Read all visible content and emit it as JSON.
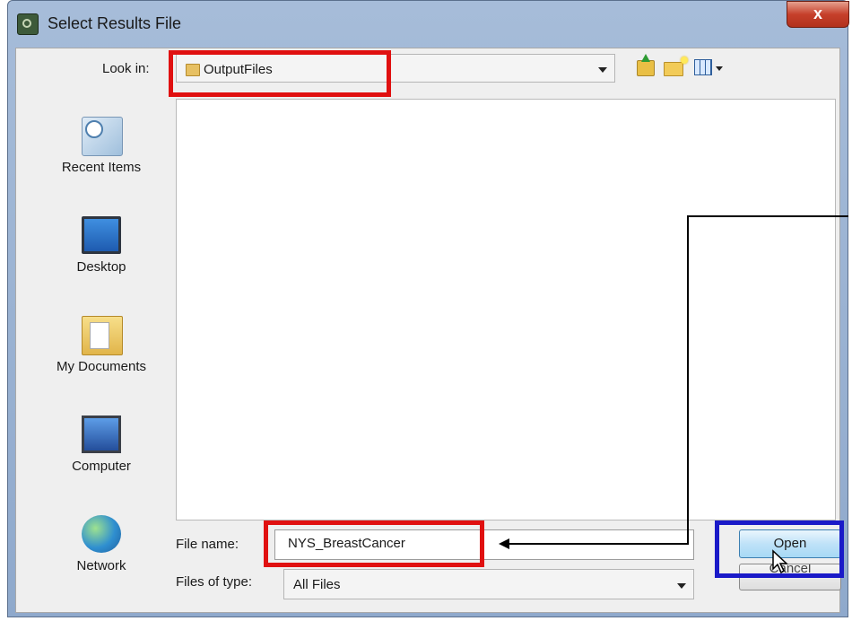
{
  "window": {
    "title": "Select Results File",
    "close_glyph": "x"
  },
  "toolbar": {
    "look_in_label": "Look in:",
    "look_in_value": "OutputFiles",
    "icons": [
      "up-one-level-icon",
      "create-new-folder-icon",
      "view-menu-icon"
    ]
  },
  "places": [
    {
      "label": "Recent Items",
      "icon": "recent-items-icon"
    },
    {
      "label": "Desktop",
      "icon": "desktop-icon"
    },
    {
      "label": "My Documents",
      "icon": "my-documents-icon"
    },
    {
      "label": "Computer",
      "icon": "computer-icon"
    },
    {
      "label": "Network",
      "icon": "network-icon"
    }
  ],
  "form": {
    "file_name_label": "File name:",
    "file_name_value": "NYS_BreastCancer",
    "file_type_label": "Files of type:",
    "file_type_value": "All Files"
  },
  "buttons": {
    "open": "Open",
    "cancel": "Cancel"
  },
  "annotations": {
    "highlight_color": "#e01010",
    "button_highlight_color": "#1a1ac8"
  }
}
